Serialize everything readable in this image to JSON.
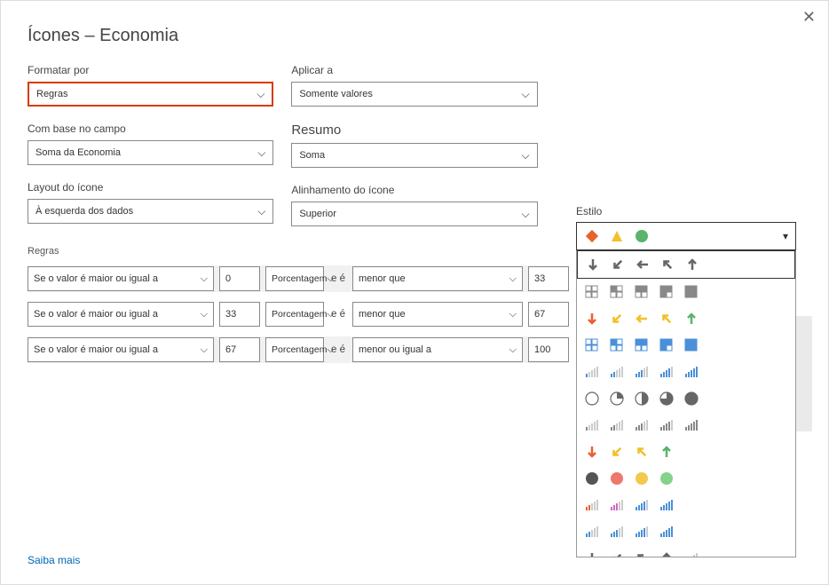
{
  "dialog": {
    "title": "Ícones – Economia",
    "close_tooltip": "Fechar"
  },
  "fields": {
    "format_by": {
      "label": "Formatar por",
      "value": "Regras"
    },
    "apply_to": {
      "label": "Aplicar a",
      "value": "Somente valores"
    },
    "based_on": {
      "label": "Com base no campo",
      "value": "Soma da Economia"
    },
    "summary": {
      "label": "Resumo",
      "value": "Soma"
    },
    "layout": {
      "label": "Layout do ícone",
      "value": "À esquerda dos dados"
    },
    "alignment": {
      "label": "Alinhamento do ícone",
      "value": "Superior"
    },
    "style": {
      "label": "Estilo"
    }
  },
  "rules_header": "Regras",
  "rules": [
    {
      "condition": "Se o valor é maior ou igual a",
      "from": "0",
      "unit": "Porcentagem",
      "mid_label": "e é",
      "mid_op": "menor que",
      "to": "33"
    },
    {
      "condition": "Se o valor é maior ou igual a",
      "from": "33",
      "unit": "Porcentagem",
      "mid_label": "e é",
      "mid_op": "menor que",
      "to": "67"
    },
    {
      "condition": "Se o valor é maior ou igual a",
      "from": "67",
      "unit": "Porcentagem",
      "mid_label": "e é",
      "mid_op": "menor ou igual a",
      "to": "100"
    }
  ],
  "style_options": {
    "selected_index": 0,
    "hover_index": 1,
    "sets": [
      {
        "id": "shapes-traffic",
        "icons": [
          {
            "t": "diamond",
            "c": "#e8602c"
          },
          {
            "t": "triangle",
            "c": "#f2c029"
          },
          {
            "t": "circle",
            "c": "#5ab46a"
          }
        ]
      },
      {
        "id": "arrows-gray-5",
        "icons": [
          {
            "t": "arrow",
            "r": 180,
            "c": "#666"
          },
          {
            "t": "arrow",
            "r": 135,
            "c": "#666"
          },
          {
            "t": "arrow",
            "r": 90,
            "c": "#666"
          },
          {
            "t": "arrow",
            "r": 45,
            "c": "#666"
          },
          {
            "t": "arrow",
            "r": 0,
            "c": "#666"
          }
        ]
      },
      {
        "id": "quadrants-gray-5",
        "icons": [
          {
            "t": "quad",
            "f": 0,
            "c": "#888"
          },
          {
            "t": "quad",
            "f": 1,
            "c": "#888"
          },
          {
            "t": "quad",
            "f": 2,
            "c": "#888"
          },
          {
            "t": "quad",
            "f": 3,
            "c": "#888"
          },
          {
            "t": "quad",
            "f": 4,
            "c": "#888"
          }
        ]
      },
      {
        "id": "arrows-color-5",
        "icons": [
          {
            "t": "arrow",
            "r": 180,
            "c": "#e8602c"
          },
          {
            "t": "arrow",
            "r": 135,
            "c": "#f2c029"
          },
          {
            "t": "arrow",
            "r": 90,
            "c": "#f2c029"
          },
          {
            "t": "arrow",
            "r": 45,
            "c": "#f2c029"
          },
          {
            "t": "arrow",
            "r": 0,
            "c": "#5ab46a"
          }
        ]
      },
      {
        "id": "quadrants-blue-5",
        "icons": [
          {
            "t": "quad",
            "f": 0,
            "c": "#4a90d9"
          },
          {
            "t": "quad",
            "f": 1,
            "c": "#4a90d9"
          },
          {
            "t": "quad",
            "f": 2,
            "c": "#4a90d9"
          },
          {
            "t": "quad",
            "f": 3,
            "c": "#4a90d9"
          },
          {
            "t": "quad",
            "f": 4,
            "c": "#4a90d9"
          }
        ]
      },
      {
        "id": "bars-blue-5",
        "icons": [
          {
            "t": "bars",
            "f": 1,
            "c": "#4a90d9"
          },
          {
            "t": "bars",
            "f": 2,
            "c": "#4a90d9"
          },
          {
            "t": "bars",
            "f": 3,
            "c": "#4a90d9"
          },
          {
            "t": "bars",
            "f": 4,
            "c": "#4a90d9"
          },
          {
            "t": "bars",
            "f": 5,
            "c": "#4a90d9"
          }
        ]
      },
      {
        "id": "pie-gray-5",
        "icons": [
          {
            "t": "pie",
            "f": 0,
            "c": "#666"
          },
          {
            "t": "pie",
            "f": 1,
            "c": "#666"
          },
          {
            "t": "pie",
            "f": 2,
            "c": "#666"
          },
          {
            "t": "pie",
            "f": 3,
            "c": "#666"
          },
          {
            "t": "pie",
            "f": 4,
            "c": "#666"
          }
        ]
      },
      {
        "id": "bars-gray-5",
        "icons": [
          {
            "t": "bars",
            "f": 1,
            "c": "#888"
          },
          {
            "t": "bars",
            "f": 2,
            "c": "#888"
          },
          {
            "t": "bars",
            "f": 3,
            "c": "#888"
          },
          {
            "t": "bars",
            "f": 4,
            "c": "#888"
          },
          {
            "t": "bars",
            "f": 5,
            "c": "#888"
          }
        ]
      },
      {
        "id": "arrows-color-4",
        "icons": [
          {
            "t": "arrow",
            "r": 180,
            "c": "#e8602c"
          },
          {
            "t": "arrow",
            "r": 135,
            "c": "#f2c029"
          },
          {
            "t": "arrow",
            "r": 45,
            "c": "#f2c029"
          },
          {
            "t": "arrow",
            "r": 0,
            "c": "#5ab46a"
          }
        ]
      },
      {
        "id": "circles-color-4",
        "icons": [
          {
            "t": "circle",
            "c": "#555"
          },
          {
            "t": "circle",
            "c": "#ed786b"
          },
          {
            "t": "circle",
            "c": "#f2c94c"
          },
          {
            "t": "circle",
            "c": "#85d28a"
          }
        ]
      },
      {
        "id": "bars-color-4",
        "icons": [
          {
            "t": "bars",
            "f": 2,
            "c": "#e8602c"
          },
          {
            "t": "bars",
            "f": 3,
            "c": "#d862c6"
          },
          {
            "t": "bars",
            "f": 4,
            "c": "#4a90d9"
          },
          {
            "t": "bars",
            "f": 5,
            "c": "#4a90d9"
          }
        ]
      },
      {
        "id": "bars-blue-4",
        "icons": [
          {
            "t": "bars",
            "f": 2,
            "c": "#4a90d9"
          },
          {
            "t": "bars",
            "f": 3,
            "c": "#4a90d9"
          },
          {
            "t": "bars",
            "f": 4,
            "c": "#4a90d9"
          },
          {
            "t": "bars",
            "f": 5,
            "c": "#4a90d9"
          }
        ]
      },
      {
        "id": "arrows-gray-4",
        "icons": [
          {
            "t": "arrow",
            "r": 180,
            "c": "#666"
          },
          {
            "t": "arrow",
            "r": 135,
            "c": "#666"
          },
          {
            "t": "arrow",
            "r": 45,
            "c": "#666"
          },
          {
            "t": "arrow",
            "r": 0,
            "c": "#666"
          },
          {
            "t": "bars",
            "f": 3,
            "c": "#888"
          }
        ]
      }
    ]
  },
  "footer": {
    "learn_more": "Saiba mais"
  }
}
